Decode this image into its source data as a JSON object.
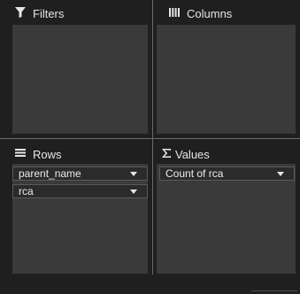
{
  "zones": {
    "filters": {
      "title": "Filters",
      "icon": "filter-icon"
    },
    "columns": {
      "title": "Columns",
      "icon": "columns-icon"
    },
    "rows": {
      "title": "Rows",
      "icon": "rows-icon",
      "items": [
        {
          "label": "parent_name"
        },
        {
          "label": "rca"
        }
      ]
    },
    "values": {
      "title": "Values",
      "icon": "sigma-icon",
      "items": [
        {
          "label": "Count of rca"
        }
      ]
    }
  },
  "colors": {
    "background": "#1f1f1f",
    "drop_area": "#3a3a3a",
    "divider": "#6a6a6a",
    "text": "#e6e6e6"
  }
}
